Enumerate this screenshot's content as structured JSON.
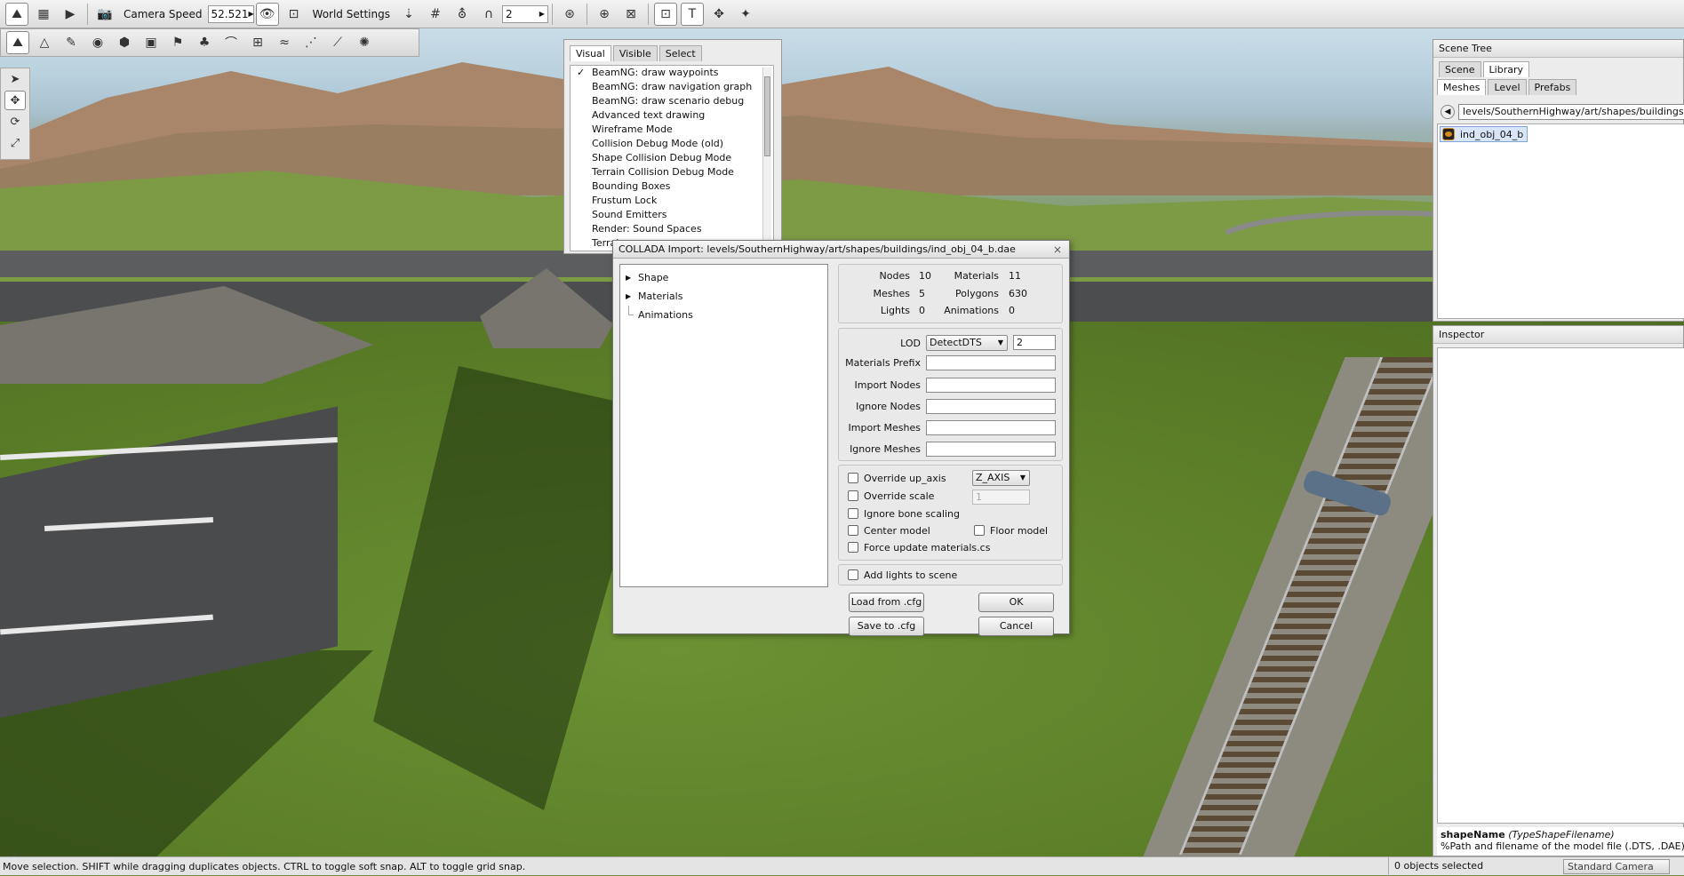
{
  "toolbar": {
    "camera_speed_label": "Camera Speed",
    "camera_speed_value": "52.521",
    "world_settings_label": "World Settings",
    "snap_value": "2"
  },
  "visibility": {
    "tabs": [
      "Visual",
      "Visible",
      "Select"
    ],
    "items": [
      {
        "label": "BeamNG: draw waypoints",
        "checked": "✓"
      },
      {
        "label": "BeamNG: draw navigation graph",
        "checked": ""
      },
      {
        "label": "BeamNG: draw scenario debug",
        "checked": ""
      },
      {
        "label": "Advanced text drawing",
        "checked": ""
      },
      {
        "label": "Wireframe Mode",
        "checked": ""
      },
      {
        "label": "Collision Debug Mode (old)",
        "checked": ""
      },
      {
        "label": "Shape Collision Debug Mode",
        "checked": ""
      },
      {
        "label": "Terrain Collision Debug Mode",
        "checked": ""
      },
      {
        "label": "Bounding Boxes",
        "checked": ""
      },
      {
        "label": "Frustum Lock",
        "checked": ""
      },
      {
        "label": "Sound Emitters",
        "checked": ""
      },
      {
        "label": "Render: Sound Spaces",
        "checked": ""
      },
      {
        "label": "Terrain",
        "checked": ""
      }
    ]
  },
  "dialog": {
    "title": "COLLADA Import: levels/SouthernHighway/art/shapes/buildings/ind_obj_04_b.dae",
    "close": "×",
    "tree": [
      "Shape",
      "Materials",
      "Animations"
    ],
    "stats": {
      "nodes_label": "Nodes",
      "nodes": "10",
      "materials_label": "Materials",
      "materials": "11",
      "meshes_label": "Meshes",
      "meshes": "5",
      "polygons_label": "Polygons",
      "polygons": "630",
      "lights_label": "Lights",
      "lights": "0",
      "animations_label": "Animations",
      "animations": "0"
    },
    "lod_label": "LOD",
    "lod_value": "DetectDTS",
    "lod_size": "2",
    "materials_prefix_label": "Materials Prefix",
    "import_nodes_label": "Import Nodes",
    "ignore_nodes_label": "Ignore Nodes",
    "import_meshes_label": "Import Meshes",
    "ignore_meshes_label": "Ignore Meshes",
    "override_up_axis_label": "Override up_axis",
    "up_axis_value": "Z_AXIS",
    "override_scale_label": "Override scale",
    "scale_value": "1",
    "ignore_bone_scaling_label": "Ignore bone scaling",
    "center_model_label": "Center model",
    "floor_model_label": "Floor model",
    "force_update_label": "Force update materials.cs",
    "add_lights_label": "Add lights to scene",
    "load_cfg": "Load from .cfg",
    "save_cfg": "Save to .cfg",
    "ok": "OK",
    "cancel": "Cancel"
  },
  "scene_tree": {
    "title": "Scene Tree",
    "tabs": [
      "Scene",
      "Library"
    ],
    "subtabs": [
      "Meshes",
      "Level",
      "Prefabs"
    ],
    "path": "levels/SouthernHighway/art/shapes/buildings",
    "items": [
      "ind_obj_04_b"
    ]
  },
  "inspector": {
    "title": "Inspector",
    "help_field": "shapeName",
    "help_type": "(TypeShapeFilename)",
    "help_text": "%Path and filename of the model file (.DTS, .DAE) to use"
  },
  "status": {
    "message": "Move selection.  SHIFT while dragging duplicates objects.  CTRL to toggle soft snap.  ALT to toggle grid snap.",
    "selection": "0 objects selected",
    "camera": "Standard Camera"
  },
  "colors": {
    "accent": "#7fa3d4",
    "sky": "#b8d0dd",
    "grass": "#5d8029"
  }
}
